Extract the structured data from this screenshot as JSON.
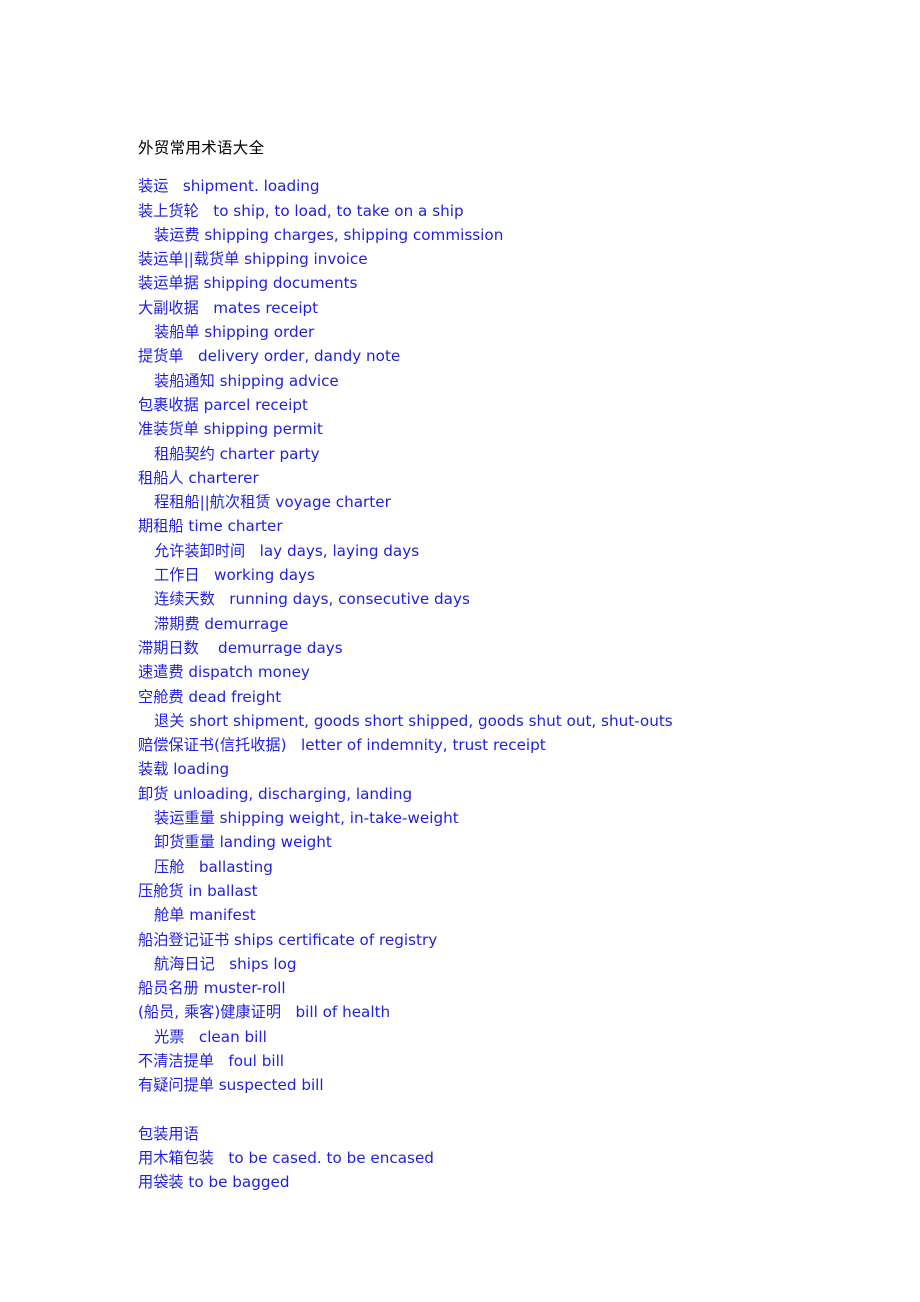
{
  "document": {
    "title": "外贸常用术语大全",
    "text_color_body": "#1f1fe0",
    "text_color_title": "#000000",
    "background_color": "#ffffff"
  },
  "lines": [
    {
      "text": "装运   shipment. loading",
      "indent": false
    },
    {
      "text": "装上货轮   to ship, to load, to take on a ship",
      "indent": false
    },
    {
      "text": "装运费 shipping charges, shipping commission",
      "indent": true
    },
    {
      "text": "装运单||载货单 shipping invoice",
      "indent": false
    },
    {
      "text": "装运单据 shipping documents",
      "indent": false
    },
    {
      "text": "大副收据   mates receipt",
      "indent": false
    },
    {
      "text": "装船单 shipping order",
      "indent": true
    },
    {
      "text": "提货单   delivery order, dandy note",
      "indent": false
    },
    {
      "text": "装船通知 shipping advice",
      "indent": true
    },
    {
      "text": "包裹收据 parcel receipt",
      "indent": false
    },
    {
      "text": "准装货单 shipping permit",
      "indent": false
    },
    {
      "text": "租船契约 charter party",
      "indent": true
    },
    {
      "text": "租船人 charterer",
      "indent": false
    },
    {
      "text": "程租船||航次租赁 voyage charter",
      "indent": true
    },
    {
      "text": "期租船 time charter",
      "indent": false
    },
    {
      "text": "允许装卸时间   lay days, laying days",
      "indent": true
    },
    {
      "text": "工作日   working days",
      "indent": true
    },
    {
      "text": "连续天数   running days, consecutive days",
      "indent": true
    },
    {
      "text": "滞期费 demurrage",
      "indent": true
    },
    {
      "text": "滞期日数    demurrage days",
      "indent": false
    },
    {
      "text": "速遣费 dispatch money",
      "indent": false
    },
    {
      "text": "空舱费 dead freight",
      "indent": false
    },
    {
      "text": "退关 short shipment, goods short shipped, goods shut out, shut-outs",
      "indent": true
    },
    {
      "text": "赔偿保证书(信托收据)   letter of indemnity, trust receipt",
      "indent": false
    },
    {
      "text": "装载 loading",
      "indent": false
    },
    {
      "text": "卸货 unloading, discharging, landing",
      "indent": false
    },
    {
      "text": "装运重量 shipping weight, in-take-weight",
      "indent": true
    },
    {
      "text": "卸货重量 landing weight",
      "indent": true
    },
    {
      "text": "压舱   ballasting",
      "indent": true
    },
    {
      "text": "压舱货 in ballast",
      "indent": false
    },
    {
      "text": "舱单 manifest",
      "indent": true
    },
    {
      "text": "船泊登记证书 ships certificate of registry",
      "indent": false
    },
    {
      "text": "航海日记   ships log",
      "indent": true
    },
    {
      "text": "船员名册 muster-roll",
      "indent": false
    },
    {
      "text": "(船员, 乘客)健康证明   bill of health",
      "indent": false
    },
    {
      "text": "光票   clean bill",
      "indent": true
    },
    {
      "text": "不清洁提单   foul bill",
      "indent": false
    },
    {
      "text": "有疑问提单 suspected bill",
      "indent": false
    },
    {
      "text": "",
      "indent": false
    },
    {
      "text": "包装用语",
      "indent": false
    },
    {
      "text": "用木箱包装   to be cased. to be encased",
      "indent": false
    },
    {
      "text": "用袋装 to be bagged",
      "indent": false
    }
  ]
}
